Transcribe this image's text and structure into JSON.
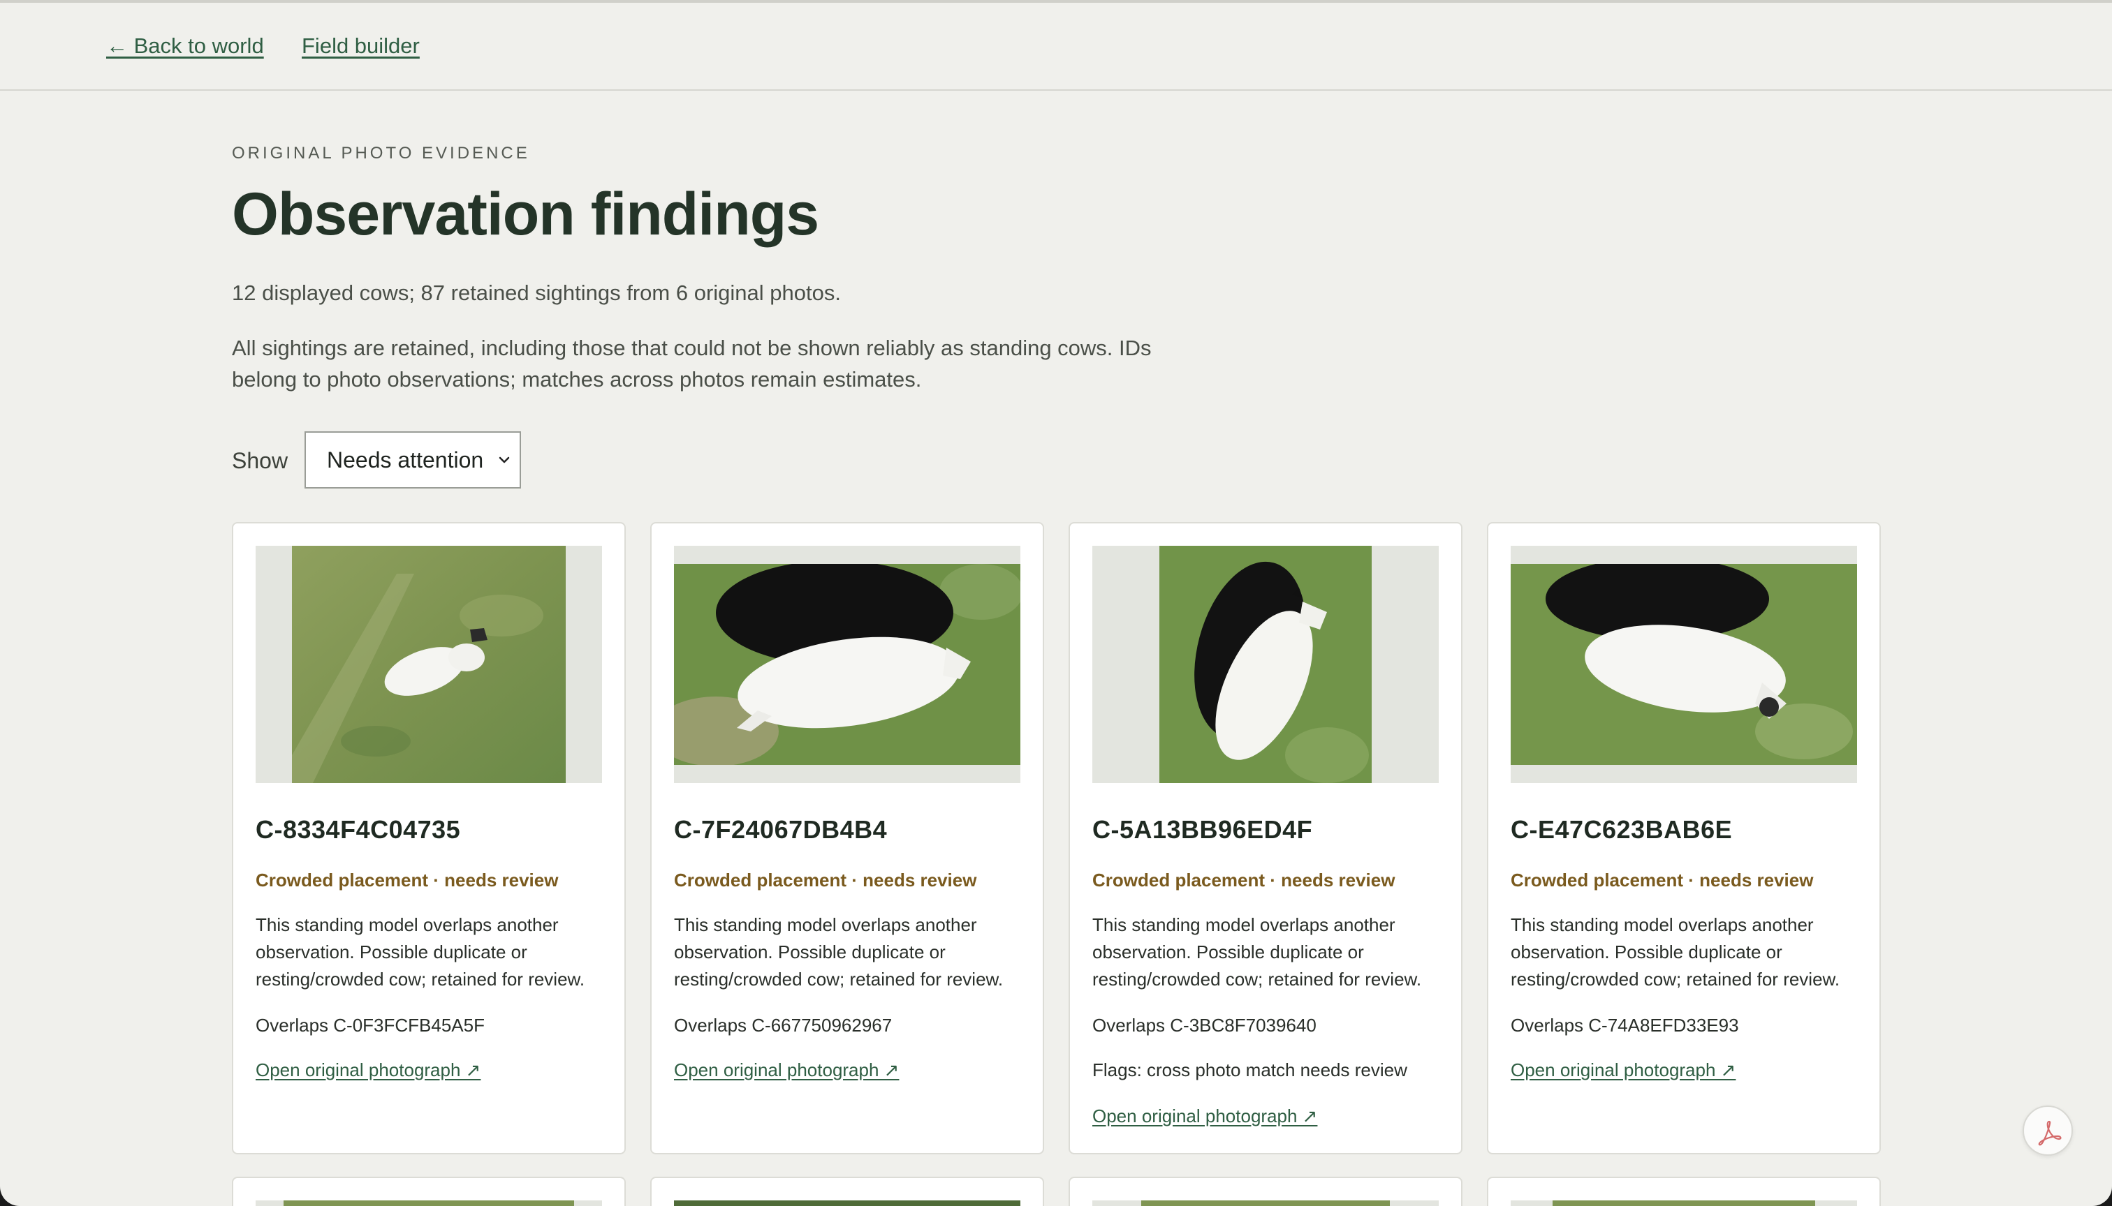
{
  "nav": {
    "back_label": "← Back to world",
    "field_builder_label": "Field builder"
  },
  "header": {
    "eyebrow": "ORIGINAL PHOTO EVIDENCE",
    "title": "Observation findings",
    "summary": "12 displayed cows; 87 retained sightings from 6 original photos.",
    "note": "All sightings are retained, including those that could not be shown reliably as standing cows. IDs belong to photo observations; matches across photos remain estimates."
  },
  "filter": {
    "label": "Show",
    "selected": "Needs attention"
  },
  "cards": [
    {
      "id": "C-8334F4C04735",
      "status": "Crowded placement · needs review",
      "description": "This standing model overlaps another observation. Possible duplicate or resting/crowded cow; retained for review.",
      "overlap": "Overlaps C-0F3FCFB45A5F",
      "link": "Open original photograph ↗"
    },
    {
      "id": "C-7F24067DB4B4",
      "status": "Crowded placement · needs review",
      "description": "This standing model overlaps another observation. Possible duplicate or resting/crowded cow; retained for review.",
      "overlap": "Overlaps C-667750962967",
      "link": "Open original photograph ↗"
    },
    {
      "id": "C-5A13BB96ED4F",
      "status": "Crowded placement · needs review",
      "description": "This standing model overlaps another observation. Possible duplicate or resting/crowded cow; retained for review.",
      "overlap": "Overlaps C-3BC8F7039640",
      "flags": "Flags: cross photo match needs review",
      "link": "Open original photograph ↗"
    },
    {
      "id": "C-E47C623BAB6E",
      "status": "Crowded placement · needs review",
      "description": "This standing model overlaps another observation. Possible duplicate or resting/crowded cow; retained for review.",
      "overlap": "Overlaps C-74A8EFD33E93",
      "link": "Open original photograph ↗"
    }
  ],
  "colors": {
    "background": "#f0f0ec",
    "accent_link": "#2f5e43",
    "status_warning": "#7a5a1e",
    "title": "#243428"
  },
  "icons": {
    "pdf_button": "pdf-icon",
    "select_chevron": "chevron-down-icon"
  }
}
